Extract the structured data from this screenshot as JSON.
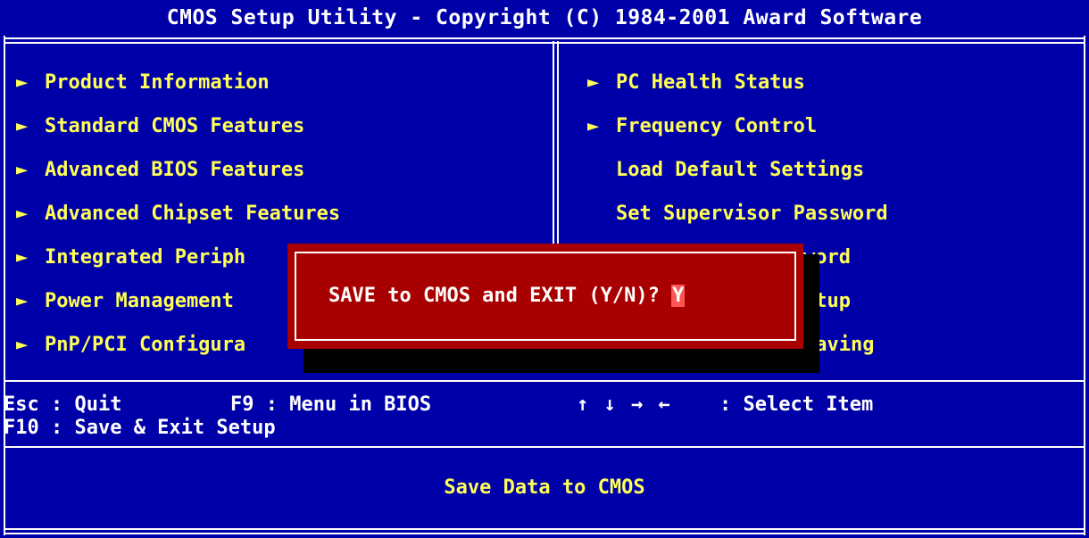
{
  "title": "CMOS Setup Utility - Copyright (C) 1984-2001 Award Software",
  "left_menu": [
    {
      "label": "Product Information",
      "submenu": true
    },
    {
      "label": "Standard CMOS Features",
      "submenu": true
    },
    {
      "label": "Advanced BIOS Features",
      "submenu": true
    },
    {
      "label": "Advanced Chipset Features",
      "submenu": true
    },
    {
      "label": "Integrated Periph",
      "submenu": true
    },
    {
      "label": "Power Management",
      "submenu": true
    },
    {
      "label": "PnP/PCI Configura",
      "submenu": true
    }
  ],
  "right_menu": [
    {
      "label": "PC Health Status",
      "submenu": true
    },
    {
      "label": "Frequency Control",
      "submenu": true
    },
    {
      "label": "Load Default Settings",
      "submenu": false
    },
    {
      "label": "Set Supervisor Password",
      "submenu": false
    },
    {
      "label": "word",
      "submenu": false
    },
    {
      "label": "etup",
      "submenu": false
    },
    {
      "label": "Saving",
      "submenu": false
    }
  ],
  "dialog": {
    "prompt": "SAVE to CMOS and EXIT (Y/N)? ",
    "input_value": "Y"
  },
  "help": {
    "esc": "Esc : Quit",
    "f9": "F9 : Menu in BIOS",
    "arrows": "↑ ↓ → ←",
    "select": ": Select Item",
    "f10": "F10 : Save & Exit Setup"
  },
  "status": "Save Data to CMOS",
  "submenu_glyph": "►",
  "colors": {
    "background": "#0000a8",
    "menu_text": "#ffff55",
    "dialog_bg": "#a80000",
    "dialog_shadow": "#000000",
    "cursor_bg": "#ff5555",
    "highlight_char_bg": "#a85400"
  }
}
